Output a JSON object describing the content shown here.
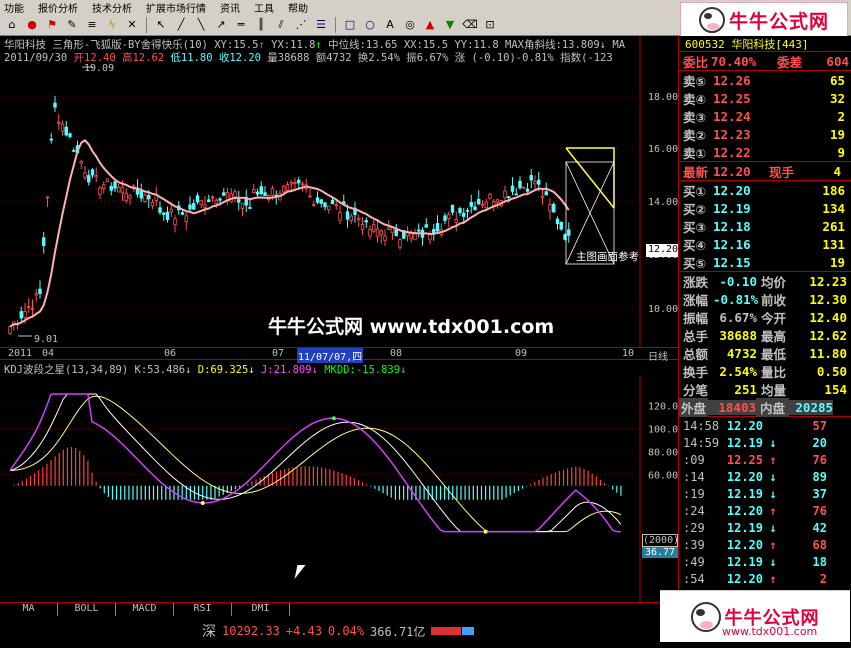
{
  "menubar": {
    "items": [
      "功能",
      "报价分析",
      "技术分析",
      "扩展市场行情",
      "资讯",
      "工具",
      "帮助"
    ]
  },
  "toolbar": {
    "icons": [
      "home-icon",
      "info-icon",
      "flag-icon",
      "pen-icon",
      "list-icon",
      "lightning-icon",
      "cross-icon",
      "pointer-icon",
      "line-icon",
      "slash-icon",
      "arrow-icon",
      "hline-icon",
      "vline-icon",
      "channel-icon",
      "fan-icon",
      "fib-icon",
      "rect-icon",
      "circle-icon",
      "text-icon",
      "bullseye-icon",
      "up-arrow-icon",
      "down-arrow-icon",
      "eraser-icon",
      "lock-icon"
    ]
  },
  "brand": {
    "name": "牛牛公式网",
    "url": "www.tdx001.com",
    "color": "#e0003c"
  },
  "main_chart": {
    "header_line1": {
      "stock": "华阳科技",
      "indicator": "三角形-飞狐版-BY舍得快乐(10)",
      "xy": "XY:15.5",
      "yx": "YX:11.8",
      "mid": "中位线:13.65",
      "xx": "XX:15.5",
      "yy": "YY:11.8",
      "max_slope": "MAX角斜线:13.809",
      "max2": "MA"
    },
    "header_line2": {
      "date": "2011/09/30",
      "open": "开12.40",
      "high": "高12.62",
      "low": "低11.80",
      "close": "收12.20",
      "vol": "量38688",
      "amt": "额4732",
      "turn": "换2.54%",
      "amp": "振6.67%",
      "chg": "涨 (-0.10)-0.81%",
      "index": "指数(-123"
    },
    "y_ticks": [
      "18.00",
      "16.00",
      "14.00",
      "12.00",
      "10.00"
    ],
    "high_label": "19.09",
    "low_label": "9.01",
    "price_tag": "12.20",
    "overlay_label": "主图画面参考",
    "watermark": "牛牛公式网 www.tdx001.com"
  },
  "x_axis": {
    "labels": [
      "2011",
      "04",
      "06",
      "07",
      "11/07/07,四",
      "08",
      "09",
      "10",
      "日线"
    ]
  },
  "kdj": {
    "header": {
      "name": "KDJ波段之星(13,34,89)",
      "k": "K:53.486",
      "d": "D:69.325",
      "j": "J:21.809",
      "mkdd": "MKDD:-15.839"
    },
    "y_ticks": [
      "120.00",
      "100.00",
      "80.00",
      "60.00"
    ],
    "tag1": "(2000)",
    "tag2": "36.77"
  },
  "bottom_tabs": [
    "MA",
    "BOLL",
    "MACD",
    "RSI",
    "DMI"
  ],
  "status": {
    "market": "深",
    "index": "10292.33",
    "change": "+4.43",
    "pct": "0.04%",
    "amount": "366.71亿"
  },
  "quote": {
    "code": "600532 华阳科技[443]",
    "weibi": {
      "label": "委比",
      "value": "70.40%",
      "diff_label": "委差",
      "diff": "604"
    },
    "asks": [
      {
        "label": "卖⑤",
        "price": "12.26",
        "vol": "65"
      },
      {
        "label": "卖④",
        "price": "12.25",
        "vol": "32"
      },
      {
        "label": "卖③",
        "price": "12.24",
        "vol": "2"
      },
      {
        "label": "卖②",
        "price": "12.23",
        "vol": "19"
      },
      {
        "label": "卖①",
        "price": "12.22",
        "vol": "9"
      }
    ],
    "last": {
      "label": "最新",
      "price": "12.20",
      "label2": "现手",
      "vol": "4"
    },
    "bids": [
      {
        "label": "买①",
        "price": "12.20",
        "vol": "186"
      },
      {
        "label": "买②",
        "price": "12.19",
        "vol": "134"
      },
      {
        "label": "买③",
        "price": "12.18",
        "vol": "261"
      },
      {
        "label": "买④",
        "price": "12.16",
        "vol": "131"
      },
      {
        "label": "买⑤",
        "price": "12.15",
        "vol": "19"
      }
    ],
    "stats": [
      {
        "l1": "涨跌",
        "v1": "-0.10",
        "l2": "均价",
        "v2": "12.23"
      },
      {
        "l1": "涨幅",
        "v1": "-0.81%",
        "l2": "前收",
        "v2": "12.30"
      },
      {
        "l1": "振幅",
        "v1": "6.67%",
        "l2": "今开",
        "v2": "12.40"
      },
      {
        "l1": "总手",
        "v1": "38688",
        "l2": "最高",
        "v2": "12.62"
      },
      {
        "l1": "总额",
        "v1": "4732",
        "l2": "最低",
        "v2": "11.80"
      },
      {
        "l1": "换手",
        "v1": "2.54%",
        "l2": "量比",
        "v2": "0.50"
      },
      {
        "l1": "分笔",
        "v1": "251",
        "l2": "均量",
        "v2": "154"
      }
    ],
    "outer": {
      "label": "外盘",
      "value": "18403"
    },
    "inner": {
      "label": "内盘",
      "value": "20285"
    },
    "ticks": [
      {
        "time": "14:58",
        "price": "12.20",
        "dir": "",
        "vol": "57"
      },
      {
        "time": "14:59",
        "price": "12.19",
        "dir": "↓",
        "vol": "20"
      },
      {
        "time": ":09",
        "price": "12.25",
        "dir": "↑",
        "vol": "76"
      },
      {
        "time": ":14",
        "price": "12.20",
        "dir": "↓",
        "vol": "89"
      },
      {
        "time": ":19",
        "price": "12.19",
        "dir": "↓",
        "vol": "37"
      },
      {
        "time": ":24",
        "price": "12.20",
        "dir": "↑",
        "vol": "76"
      },
      {
        "time": ":29",
        "price": "12.19",
        "dir": "↓",
        "vol": "42"
      },
      {
        "time": ":39",
        "price": "12.20",
        "dir": "↑",
        "vol": "68"
      },
      {
        "time": ":49",
        "price": "12.19",
        "dir": "↓",
        "vol": "18"
      },
      {
        "time": ":54",
        "price": "12.20",
        "dir": "↑",
        "vol": "2"
      }
    ]
  }
}
